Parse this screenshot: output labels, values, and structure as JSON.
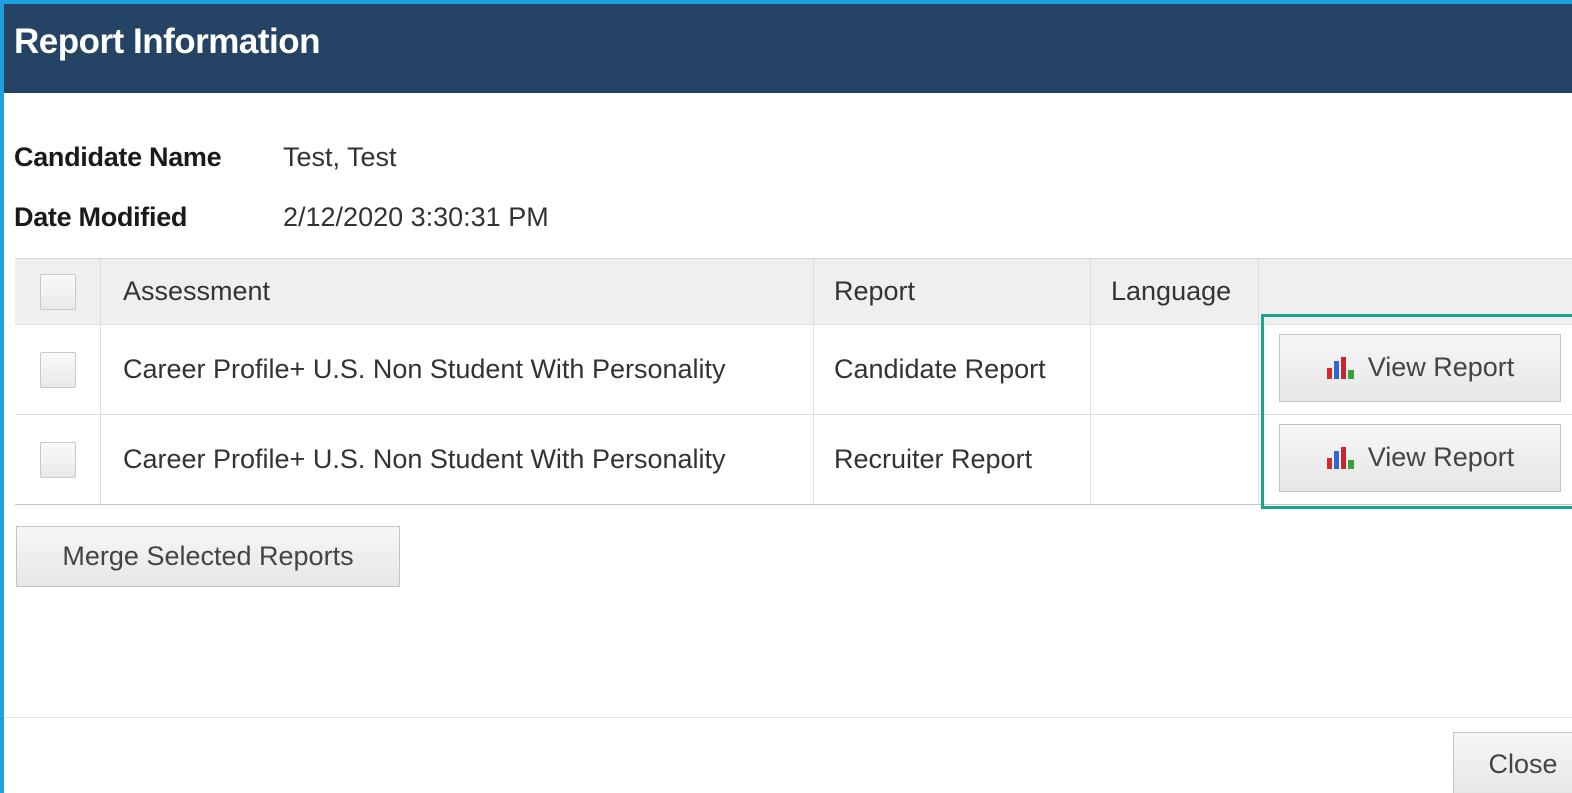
{
  "dialog": {
    "title": "Report Information",
    "accent_color": "#254465",
    "border_color": "#1ea0dc",
    "highlight_color": "#1aa58a"
  },
  "info": {
    "candidate_name_label": "Candidate Name",
    "candidate_name_value": "Test, Test",
    "date_modified_label": "Date Modified",
    "date_modified_value": "2/12/2020 3:30:31 PM"
  },
  "table": {
    "headers": {
      "assessment": "Assessment",
      "report": "Report",
      "language": "Language",
      "action": ""
    },
    "rows": [
      {
        "assessment": "Career Profile+ U.S. Non Student With Personality",
        "report": "Candidate Report",
        "language": "",
        "button_label": "View Report",
        "icon": "bar-chart-icon"
      },
      {
        "assessment": "Career Profile+ U.S. Non Student With Personality",
        "report": "Recruiter Report",
        "language": "",
        "button_label": "View Report",
        "icon": "bar-chart-icon"
      }
    ]
  },
  "actions": {
    "merge_label": "Merge Selected Reports",
    "close_label": "Close"
  }
}
